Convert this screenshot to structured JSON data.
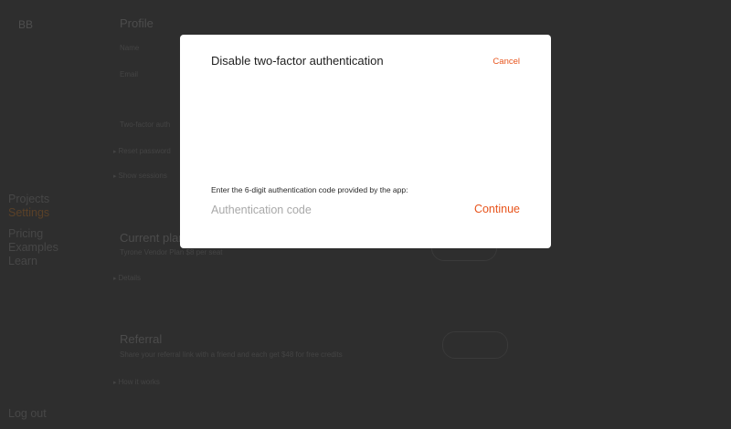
{
  "app": {
    "avatar_initials": "BB",
    "sidebar": {
      "items": [
        {
          "label": "Projects"
        },
        {
          "label": "Settings"
        },
        {
          "label": "Pricing"
        },
        {
          "label": "Examples"
        },
        {
          "label": "Learn"
        }
      ],
      "logout_label": "Log out"
    },
    "profile": {
      "title": "Profile",
      "name_label": "Name",
      "email_label": "Email",
      "two_factor_label": "Two-factor auth",
      "bullet_1": "Reset password",
      "bullet_2": "Show sessions"
    },
    "plan": {
      "title": "Current plan",
      "description": "Tyrone Vendor Plan $8 per seat",
      "bullet_1": "Details"
    },
    "referral": {
      "title": "Referral",
      "description": "Share your referral link with a friend and each get $48 for free credits",
      "bullet_1": "How it works"
    }
  },
  "modal": {
    "title": "Disable two-factor authentication",
    "cancel_label": "Cancel",
    "instruction": "Enter the 6-digit authentication code provided by the app:",
    "code_placeholder": "Authentication code",
    "code_value": "",
    "continue_label": "Continue"
  },
  "colors": {
    "accent": "#e8541c",
    "overlay": "#2e2e2e",
    "modal_bg": "#ffffff"
  }
}
